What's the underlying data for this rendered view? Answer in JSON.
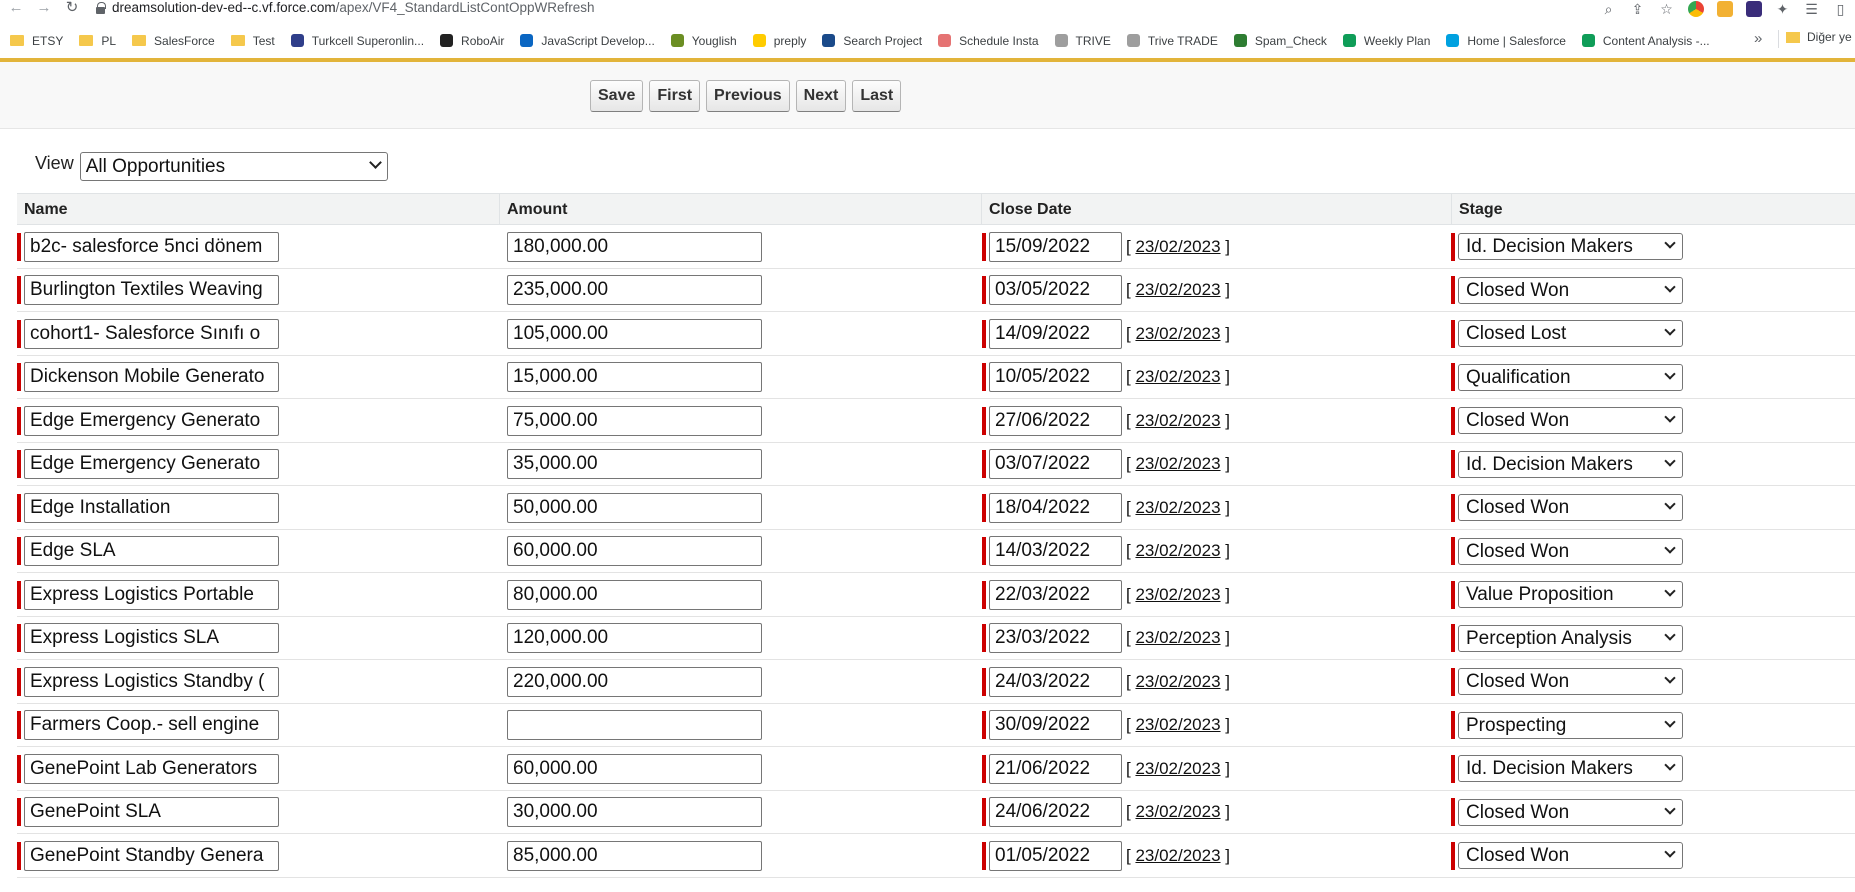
{
  "browser": {
    "url_host": "dreamsolution-dev-ed--c.vf.force.com",
    "url_path": "/apex/VF4_StandardListContOppWRefresh",
    "bookmarks": [
      {
        "label": "ETSY",
        "icon": "folder-icon",
        "color": "#f5c84c"
      },
      {
        "label": "PL",
        "icon": "folder-icon",
        "color": "#f5c84c"
      },
      {
        "label": "SalesForce",
        "icon": "folder-icon",
        "color": "#f5c84c"
      },
      {
        "label": "Test",
        "icon": "folder-icon",
        "color": "#f5c84c"
      },
      {
        "label": "Turkcell Superonlin...",
        "icon": "turkcell-icon",
        "color": "#2f3e8a"
      },
      {
        "label": "RoboAir",
        "icon": "roboair-icon",
        "color": "#222222"
      },
      {
        "label": "JavaScript Develop...",
        "icon": "linkedin-icon",
        "color": "#0a66c2"
      },
      {
        "label": "Youglish",
        "icon": "youglish-icon",
        "color": "#6b8e23"
      },
      {
        "label": "preply",
        "icon": "preply-icon",
        "color": "#ffcc00"
      },
      {
        "label": "Search Project",
        "icon": "search-project-icon",
        "color": "#1a4a8a"
      },
      {
        "label": "Schedule Insta",
        "icon": "heart-icon",
        "color": "#e57373"
      },
      {
        "label": "TRIVE",
        "icon": "trive-icon",
        "color": "#9e9e9e"
      },
      {
        "label": "Trive TRADE",
        "icon": "trive-icon",
        "color": "#9e9e9e"
      },
      {
        "label": "Spam_Check",
        "icon": "palm-icon",
        "color": "#2e7d32"
      },
      {
        "label": "Weekly Plan",
        "icon": "sheets-icon",
        "color": "#0f9d58"
      },
      {
        "label": "Home | Salesforce",
        "icon": "salesforce-icon",
        "color": "#00a1e0"
      },
      {
        "label": "Content Analysis -...",
        "icon": "check-icon",
        "color": "#0f9d58"
      }
    ],
    "bookmarks_more": "»",
    "other_bookmarks": "Diğer ye"
  },
  "toolbar": {
    "save_label": "Save",
    "first_label": "First",
    "previous_label": "Previous",
    "next_label": "Next",
    "last_label": "Last"
  },
  "view": {
    "label": "View",
    "selected": "All Opportunities"
  },
  "table": {
    "columns": [
      "Name",
      "Amount",
      "Close Date",
      "Stage"
    ],
    "today_link": "23/02/2023",
    "rows": [
      {
        "name": "b2c- salesforce 5nci dönem",
        "amount": "180,000.00",
        "close_date": "15/09/2022",
        "stage": "Id. Decision Makers"
      },
      {
        "name": "Burlington Textiles Weaving",
        "amount": "235,000.00",
        "close_date": "03/05/2022",
        "stage": "Closed Won"
      },
      {
        "name": "cohort1- Salesforce Sınıfı o",
        "amount": "105,000.00",
        "close_date": "14/09/2022",
        "stage": "Closed Lost"
      },
      {
        "name": "Dickenson Mobile Generato",
        "amount": "15,000.00",
        "close_date": "10/05/2022",
        "stage": "Qualification"
      },
      {
        "name": "Edge Emergency Generato",
        "amount": "75,000.00",
        "close_date": "27/06/2022",
        "stage": "Closed Won"
      },
      {
        "name": "Edge Emergency Generato",
        "amount": "35,000.00",
        "close_date": "03/07/2022",
        "stage": "Id. Decision Makers"
      },
      {
        "name": "Edge Installation",
        "amount": "50,000.00",
        "close_date": "18/04/2022",
        "stage": "Closed Won"
      },
      {
        "name": "Edge SLA",
        "amount": "60,000.00",
        "close_date": "14/03/2022",
        "stage": "Closed Won"
      },
      {
        "name": "Express Logistics Portable ",
        "amount": "80,000.00",
        "close_date": "22/03/2022",
        "stage": "Value Proposition"
      },
      {
        "name": "Express Logistics SLA",
        "amount": "120,000.00",
        "close_date": "23/03/2022",
        "stage": "Perception Analysis"
      },
      {
        "name": "Express Logistics Standby (",
        "amount": "220,000.00",
        "close_date": "24/03/2022",
        "stage": "Closed Won"
      },
      {
        "name": "Farmers Coop.- sell engine",
        "amount": "",
        "close_date": "30/09/2022",
        "stage": "Prospecting"
      },
      {
        "name": "GenePoint Lab Generators",
        "amount": "60,000.00",
        "close_date": "21/06/2022",
        "stage": "Id. Decision Makers"
      },
      {
        "name": "GenePoint SLA",
        "amount": "30,000.00",
        "close_date": "24/06/2022",
        "stage": "Closed Won"
      },
      {
        "name": "GenePoint Standby Genera",
        "amount": "85,000.00",
        "close_date": "01/05/2022",
        "stage": "Closed Won"
      }
    ]
  },
  "colors": {
    "required_bar": "#cc0000",
    "accent_line": "#e2b43a"
  }
}
